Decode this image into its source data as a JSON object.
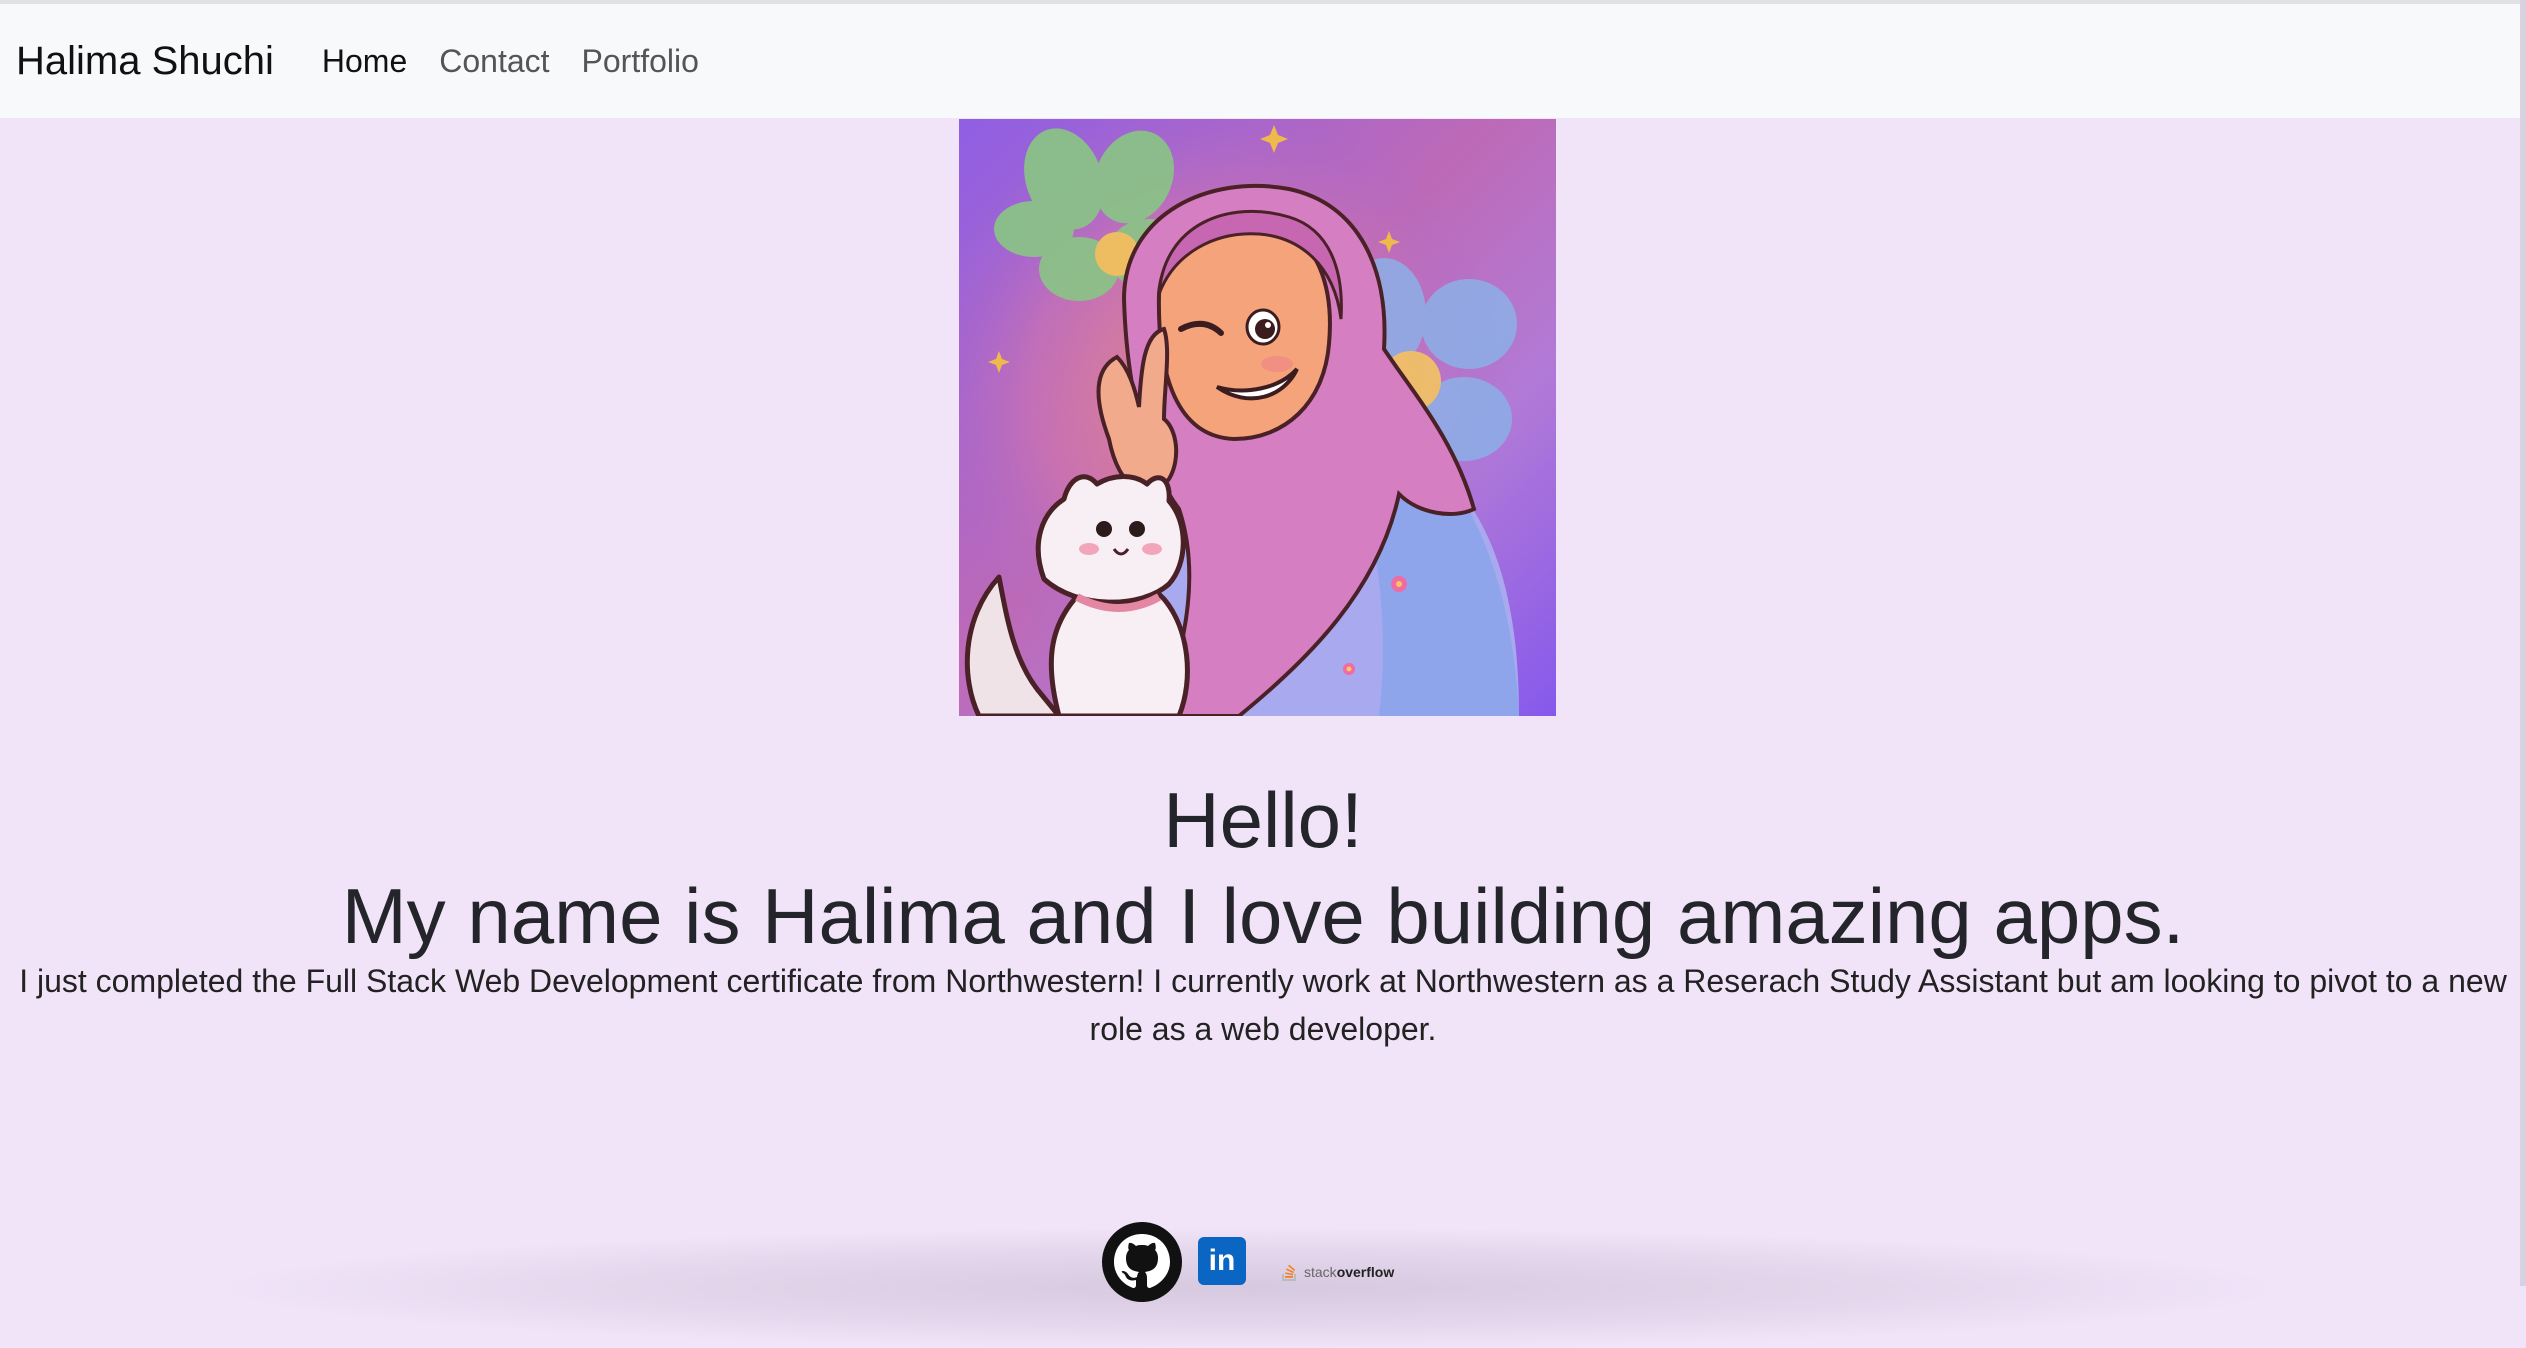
{
  "navbar": {
    "brand": "Halima Shuchi",
    "links": [
      {
        "label": "Home",
        "active": true
      },
      {
        "label": "Contact",
        "active": false
      },
      {
        "label": "Portfolio",
        "active": false
      }
    ]
  },
  "hero": {
    "image_name": "avatar-illustration",
    "hello": "Hello!",
    "tagline": "My name is Halima and I love building amazing apps.",
    "bio": "I just completed the Full Stack Web Development certificate from Northwestern! I currently work at Northwestern as a Reserach Study Assistant but am looking to pivot to a new role as a web developer."
  },
  "social": {
    "github": {
      "icon": "github-icon"
    },
    "linkedin": {
      "icon": "linkedin-icon",
      "label": "in"
    },
    "stackoverflow": {
      "icon": "stackoverflow-icon",
      "label_light": "stack",
      "label_bold": "overflow"
    }
  },
  "colors": {
    "page_background": "#f1e4f9",
    "navbar_background": "#f8f9fa",
    "linkedin_blue": "#0a66c2",
    "stackoverflow_orange": "#f48024",
    "avatar_background_purple": "#8d5fd2",
    "hijab_pink": "#cf74b6"
  }
}
